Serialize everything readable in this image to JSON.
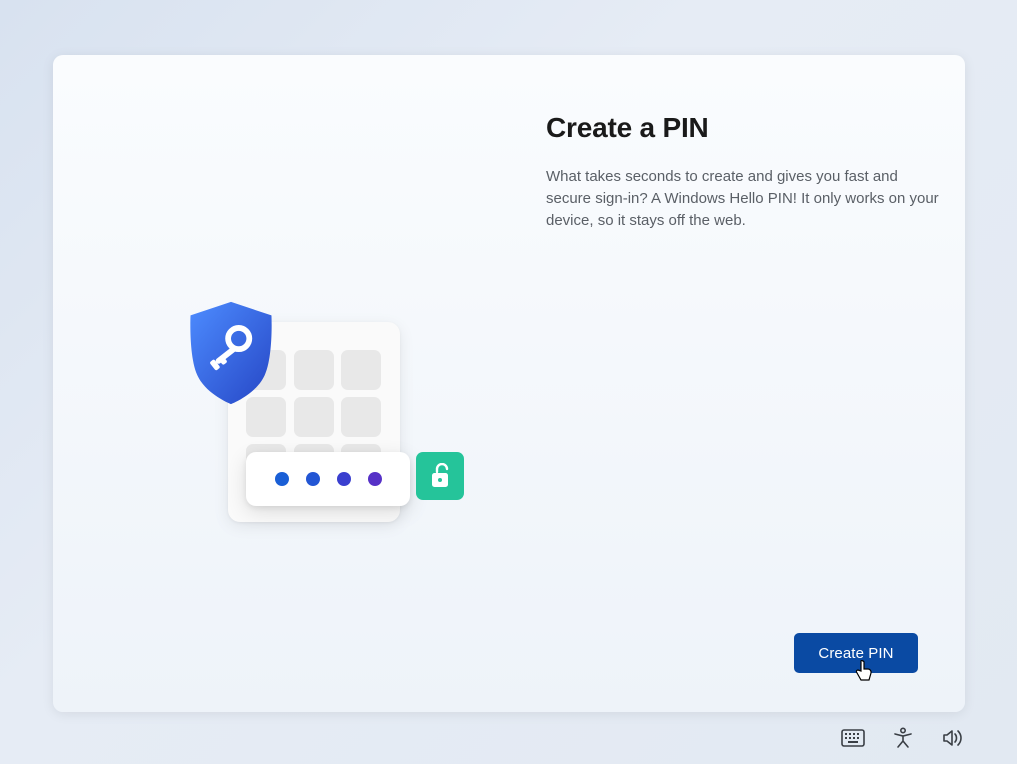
{
  "title": "Create a PIN",
  "description": "What takes seconds to create and gives you fast and secure sign-in? A Windows Hello PIN! It only works on your device, so it stays off the web.",
  "button_label": "Create PIN",
  "colors": {
    "primary": "#0a4aa3",
    "shield_start": "#4d8cff",
    "shield_end": "#2646c5",
    "lock_badge": "#25c49a"
  },
  "icons": {
    "illustration_shield": "shield-key-icon",
    "illustration_lock": "unlock-icon",
    "keyboard": "keyboard-icon",
    "accessibility": "accessibility-icon",
    "volume": "volume-icon"
  }
}
